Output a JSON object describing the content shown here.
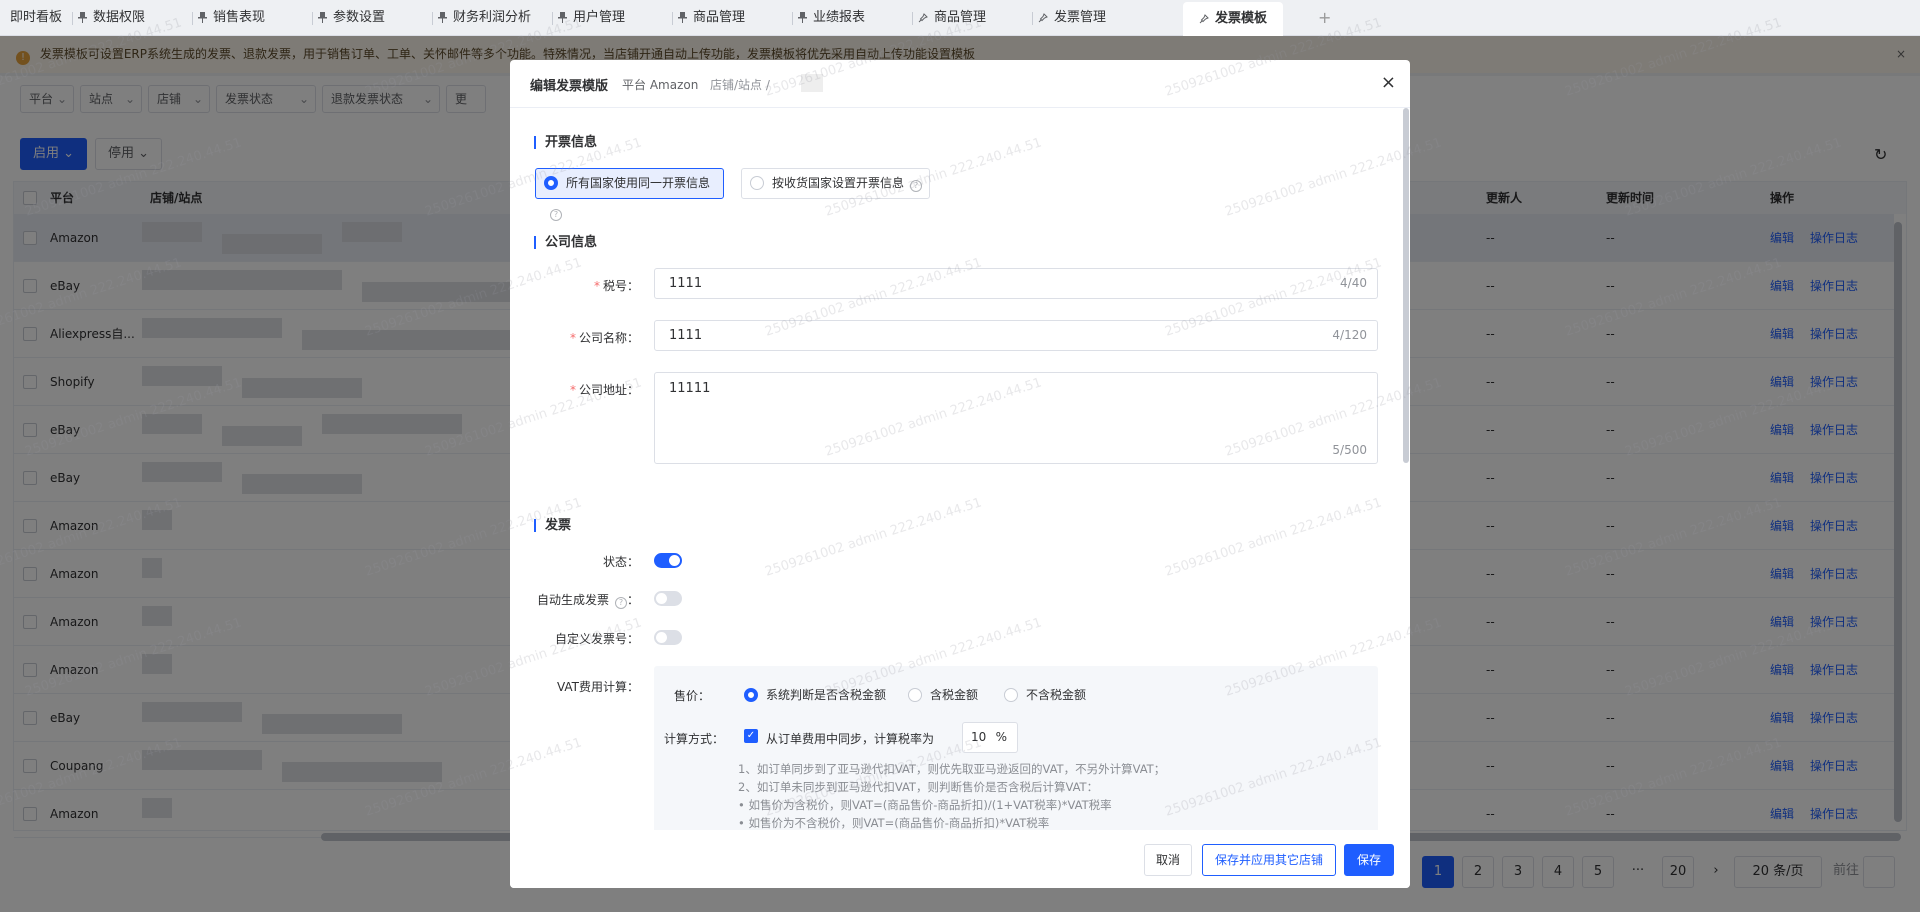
{
  "tabs": [
    {
      "label": "即时看板",
      "pin": "none"
    },
    {
      "label": "数据权限",
      "pin": "filled"
    },
    {
      "label": "销售表现",
      "pin": "filled"
    },
    {
      "label": "参数设置",
      "pin": "filled"
    },
    {
      "label": "财务利润分析",
      "pin": "filled"
    },
    {
      "label": "用户管理",
      "pin": "filled"
    },
    {
      "label": "商品管理",
      "pin": "filled"
    },
    {
      "label": "业绩报表",
      "pin": "filled"
    },
    {
      "label": "商品管理",
      "pin": "outline"
    },
    {
      "label": "发票管理",
      "pin": "outline"
    },
    {
      "label": "发票模板",
      "pin": "outline",
      "active": true
    }
  ],
  "add_tab": "+",
  "alert": {
    "text": "发票模板可设置ERP系统生成的发票、退款发票，用于销售订单、工单、关怀邮件等多个功能。特殊情况，当店铺开通自动上传功能，发票模板将优先采用自动上传功能设置模板",
    "close": "×",
    "icon": "!"
  },
  "filters": [
    "平台",
    "站点",
    "店铺",
    "发票状态",
    "退款发票状态",
    "更"
  ],
  "actions": {
    "enable": "启用",
    "disable": "停用"
  },
  "table": {
    "headers": {
      "platform": "平台",
      "store": "店铺/站点",
      "updater": "更新人",
      "updated_at": "更新时间",
      "ops": "操作"
    },
    "rows": [
      {
        "platform": "Amazon",
        "updater": "--",
        "updated_at": "--"
      },
      {
        "platform": "eBay",
        "updater": "--",
        "updated_at": "--"
      },
      {
        "platform": "Aliexpress自...",
        "updater": "--",
        "updated_at": "--"
      },
      {
        "platform": "Shopify",
        "updater": "--",
        "updated_at": "--"
      },
      {
        "platform": "eBay",
        "updater": "--",
        "updated_at": "--"
      },
      {
        "platform": "eBay",
        "updater": "--",
        "updated_at": "--"
      },
      {
        "platform": "Amazon",
        "updater": "--",
        "updated_at": "--"
      },
      {
        "platform": "Amazon",
        "updater": "--",
        "updated_at": "--"
      },
      {
        "platform": "Amazon",
        "updater": "--",
        "updated_at": "--"
      },
      {
        "platform": "Amazon",
        "updater": "--",
        "updated_at": "--"
      },
      {
        "platform": "eBay",
        "updater": "--",
        "updated_at": "--"
      },
      {
        "platform": "Coupang",
        "updater": "--",
        "updated_at": "--"
      },
      {
        "platform": "Amazon",
        "updater": "--",
        "updated_at": "--"
      }
    ],
    "edit": "编辑",
    "log": "操作日志"
  },
  "pagination": {
    "pages": [
      "1",
      "2",
      "3",
      "4",
      "5"
    ],
    "ellipsis": "···",
    "last": "20",
    "next": "›",
    "page_size": "20 条/页",
    "goto": "前往",
    "current": 1
  },
  "modal": {
    "title": "编辑发票模版",
    "platform": "平台 Amazon",
    "store": "店铺/站点 /",
    "close": "×",
    "sec_invoice_info": "开票信息",
    "opt_all": "所有国家使用同一开票信息",
    "opt_by_country": "按收货国家设置开票信息",
    "sec_company": "公司信息",
    "tax_label": "税号：",
    "tax_value": "1111",
    "tax_count": "4/40",
    "name_label": "公司名称：",
    "name_value": "1111",
    "name_count": "4/120",
    "addr_label": "公司地址：",
    "addr_value": "11111",
    "addr_count": "5/500",
    "sec_invoice": "发票",
    "status_label": "状态：",
    "status_on": true,
    "auto_label": "自动生成发票",
    "auto_on": false,
    "colon": "：",
    "custom_label": "自定义发票号：",
    "custom_on": false,
    "vat_label": "VAT费用计算：",
    "price_label": "售价：",
    "price_opts": [
      "系统判断是否含税金额",
      "含税金额",
      "不含税金额"
    ],
    "calc_label": "计算方式：",
    "calc_check": "从订单费用中同步，计算税率为",
    "rate": "10",
    "pct": "%",
    "notes": [
      "1、如订单同步到了亚马逊代扣VAT，则优先取亚马逊返回的VAT，不另外计算VAT；",
      "2、如订单未同步到亚马逊代扣VAT，则判断售价是否含税后计算VAT：",
      "如售价为含税价，则VAT=(商品售价-商品折扣)/(1+VAT税率)*VAT税率",
      "如售价为不含税价，则VAT=(商品售价-商品折扣)*VAT税率"
    ],
    "cancel": "取消",
    "save_apply": "保存并应用其它店铺",
    "save": "保存"
  },
  "watermark": "2509261002 admin 222.240.44.51",
  "colors": {
    "primary": "#1f5eff",
    "warning": "#e6a23c"
  }
}
